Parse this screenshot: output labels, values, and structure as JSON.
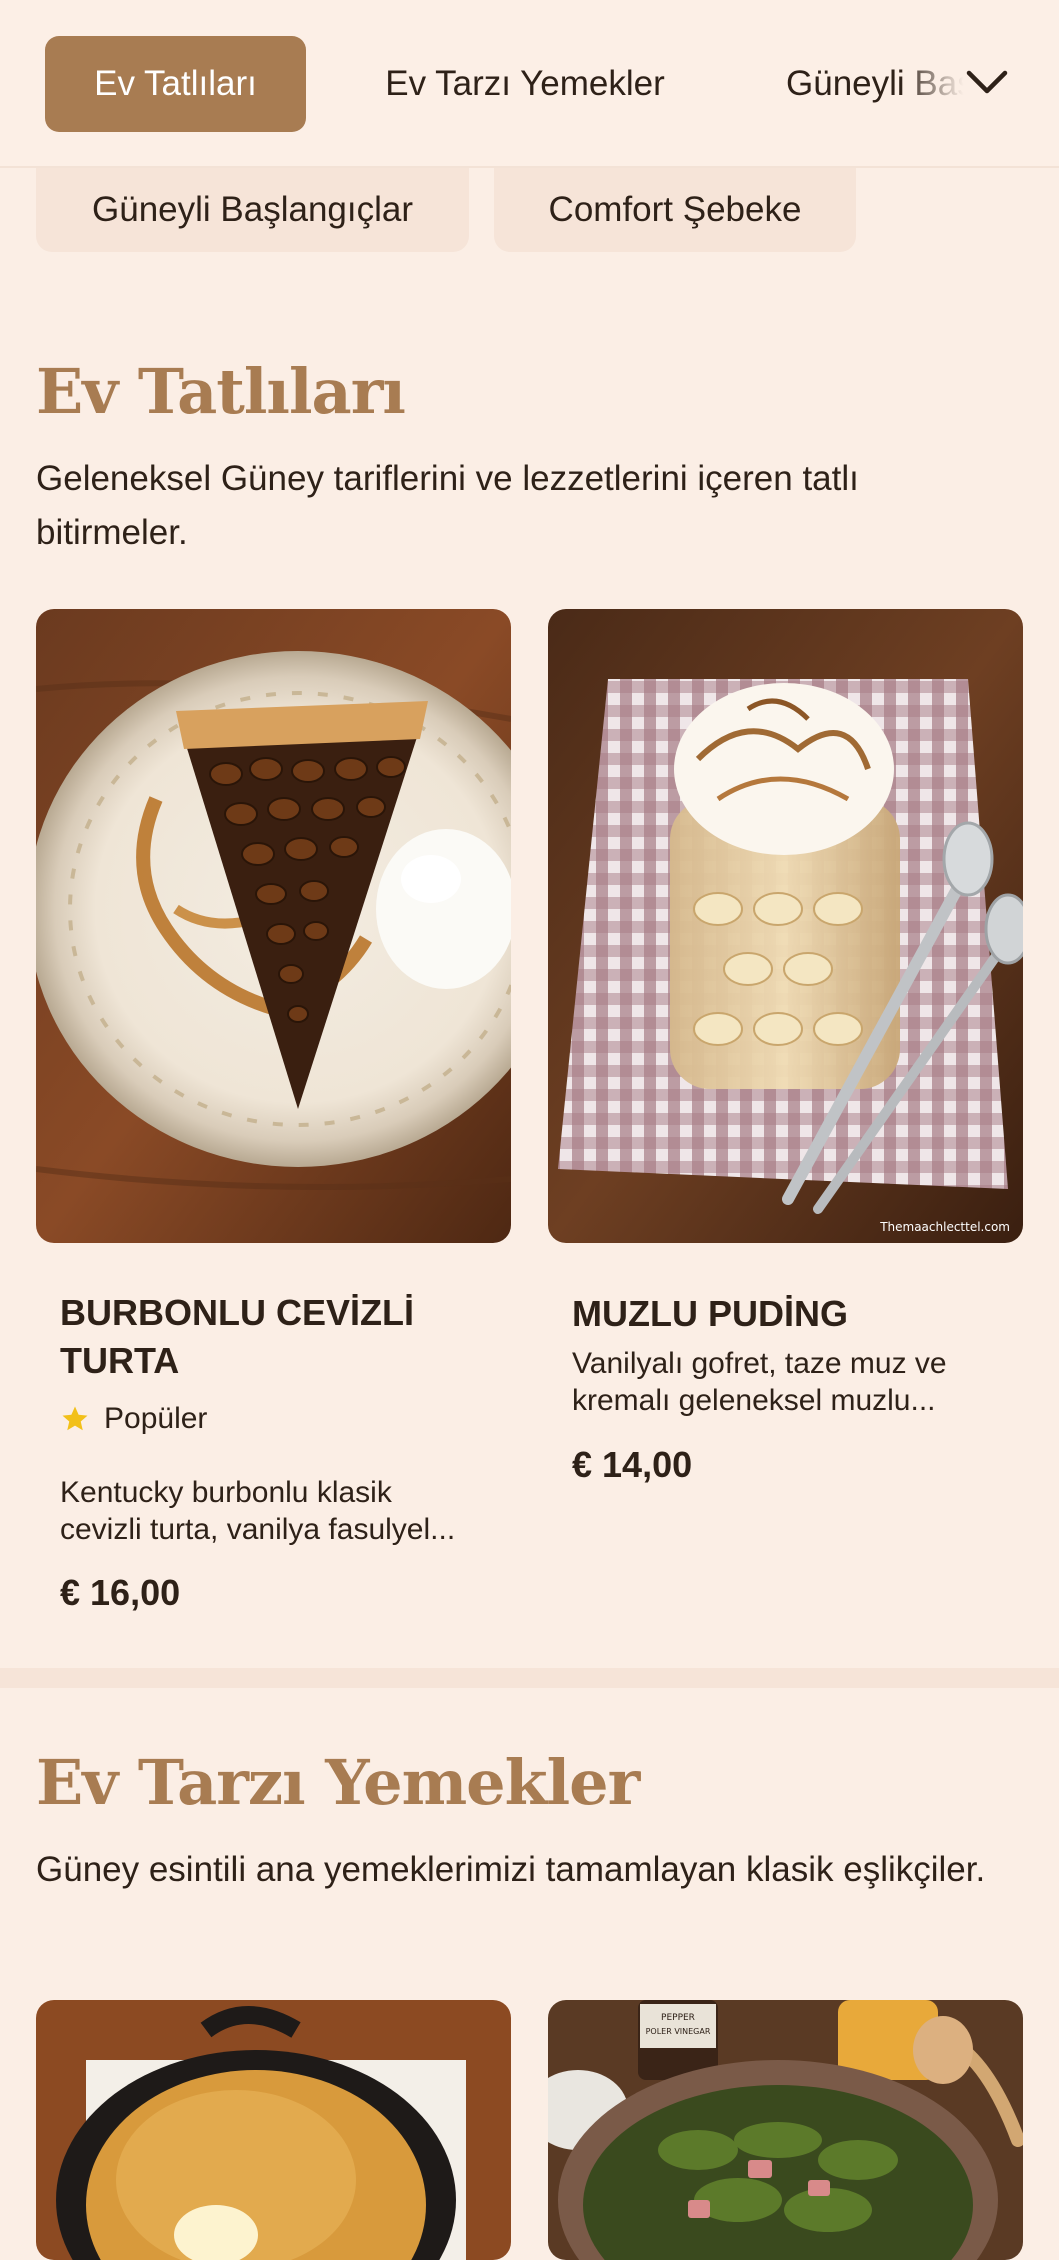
{
  "nav": {
    "tabs": [
      {
        "label": "Ev Tatlıları",
        "active": true
      },
      {
        "label": "Ev Tarzı Yemekler",
        "active": false
      },
      {
        "label": "Güneyli Başlangıçlar",
        "active": false
      }
    ],
    "chevron_icon": "chevron-down-icon"
  },
  "chips": [
    {
      "label": "Güneyli Başlangıçlar"
    },
    {
      "label": "Comfort Şebeke"
    }
  ],
  "sections": [
    {
      "title": "Ev Tatlıları",
      "description": "Geleneksel Güney tariflerini ve lezzetlerini içeren tatlı bitirmeler.",
      "items": [
        {
          "name_line1": "BURBONLU CEVİZLİ",
          "name_line2": "TURTA",
          "badge": "Popüler",
          "desc_line1": "Kentucky burbonlu klasik",
          "desc_line2": "cevizli turta, vanilya fasulyel...",
          "price": "€ 16,00",
          "image": "pecan-pie-slice-photo"
        },
        {
          "name_line1": "MUZLU PUDİNG",
          "desc_line1": "Vanilyalı gofret, taze muz ve",
          "desc_line2": "kremalı geleneksel muzlu...",
          "price": "€ 14,00",
          "image": "banana-pudding-jar-photo",
          "watermark": "Themaachlecttel.com"
        }
      ]
    },
    {
      "title": "Ev Tarzı Yemekler",
      "description": "Güney esintili ana yemeklerimizi tamamlayan klasik eşlikçiler.",
      "items": [
        {
          "image": "cornbread-skillet-photo"
        },
        {
          "image": "collard-greens-pot-photo",
          "bottle_label": "PEPPER\nPOLER VINEGAR"
        }
      ]
    }
  ],
  "colors": {
    "accent": "#a87c52",
    "background": "#fbeee5",
    "text": "#2e2118",
    "star": "#f2c019"
  }
}
